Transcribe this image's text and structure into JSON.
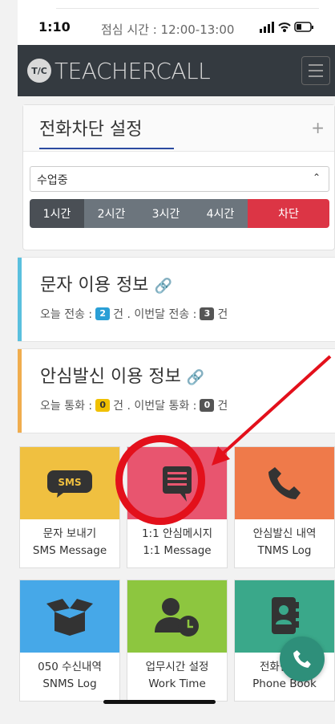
{
  "status_bar": {
    "time": "1:10",
    "lunch_label": "점심 시간 : 12:00-13:00"
  },
  "navbar": {
    "logo_badge": "T/C",
    "logo_text": "TEACHERCALL"
  },
  "call_block": {
    "title": "전화차단 설정",
    "plus": "+",
    "select_value": "수업중",
    "buttons": [
      {
        "label": "1시간",
        "color": "#4a4f55"
      },
      {
        "label": "2시간",
        "color": "#6c757d"
      },
      {
        "label": "3시간",
        "color": "#6c757d"
      },
      {
        "label": "4시간",
        "color": "#6c757d"
      },
      {
        "label": "차단",
        "color": "#dc3545"
      }
    ]
  },
  "sms_info": {
    "title": "문자 이용 정보",
    "today_label": "오늘 전송 :",
    "today_count": "2",
    "unit1": "건 . 이번달 전송 :",
    "month_count": "3",
    "unit2": "건",
    "accent": "#5bc0de"
  },
  "safe_info": {
    "title": "안심발신 이용 정보",
    "today_label": "오늘 통화 :",
    "today_count": "0",
    "unit1": "건 . 이번달 통화 :",
    "month_count": "0",
    "unit2": "건",
    "accent": "#f0ad4e"
  },
  "tiles": [
    {
      "icon": "sms-icon",
      "icon_text": "SMS",
      "line1": "문자 보내기",
      "line2": "SMS Message",
      "color": "#f0c040"
    },
    {
      "icon": "message-list-icon",
      "line1": "1:1 안심메시지",
      "line2": "1:1 Message",
      "color": "#e8556f"
    },
    {
      "icon": "phone-icon",
      "line1": "안심발신 내역",
      "line2": "TNMS Log",
      "color": "#ef7a4a"
    },
    {
      "icon": "open-box-icon",
      "line1": "050 수신내역",
      "line2": "SNMS Log",
      "color": "#46a8e8"
    },
    {
      "icon": "user-clock-icon",
      "line1": "업무시간 설정",
      "line2": "Work Time",
      "color": "#8dc63f"
    },
    {
      "icon": "address-book-icon",
      "line1": "전화번호부",
      "line2": "Phone Book",
      "color": "#3aa88a"
    }
  ]
}
